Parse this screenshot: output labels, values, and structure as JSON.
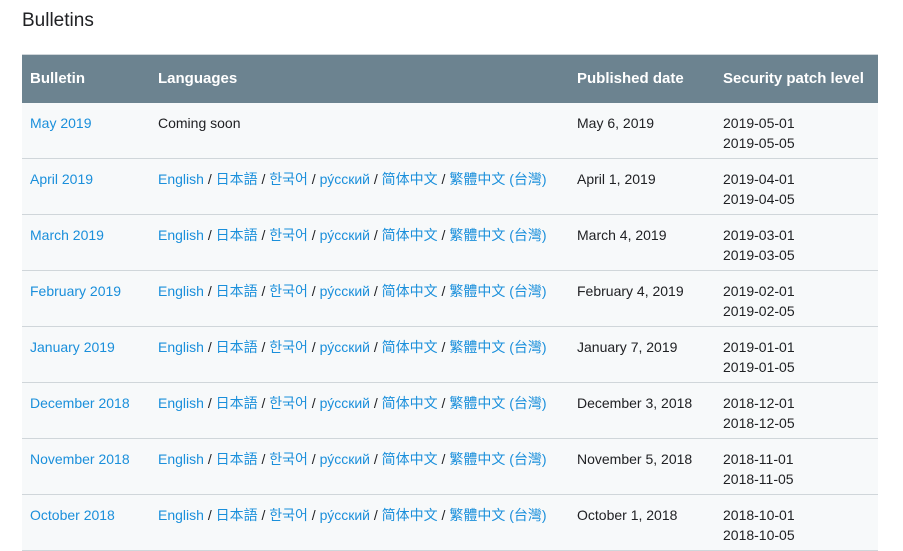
{
  "title": "Bulletins",
  "headers": {
    "bulletin": "Bulletin",
    "languages": "Languages",
    "published": "Published date",
    "patch": "Security patch level"
  },
  "language_links": [
    "English",
    "日本語",
    "한국어",
    "ру́сский",
    "简体中文",
    "繁體中文 (台灣)"
  ],
  "separator": "/",
  "rows": [
    {
      "bulletin": "May 2019",
      "languages_text": "Coming soon",
      "published": "May 6, 2019",
      "patch1": "2019-05-01",
      "patch2": "2019-05-05"
    },
    {
      "bulletin": "April 2019",
      "published": "April 1, 2019",
      "patch1": "2019-04-01",
      "patch2": "2019-04-05"
    },
    {
      "bulletin": "March 2019",
      "published": "March 4, 2019",
      "patch1": "2019-03-01",
      "patch2": "2019-03-05"
    },
    {
      "bulletin": "February 2019",
      "published": "February 4, 2019",
      "patch1": "2019-02-01",
      "patch2": "2019-02-05"
    },
    {
      "bulletin": "January 2019",
      "published": "January 7, 2019",
      "patch1": "2019-01-01",
      "patch2": "2019-01-05"
    },
    {
      "bulletin": "December 2018",
      "published": "December 3, 2018",
      "patch1": "2018-12-01",
      "patch2": "2018-12-05"
    },
    {
      "bulletin": "November 2018",
      "published": "November 5, 2018",
      "patch1": "2018-11-01",
      "patch2": "2018-11-05"
    },
    {
      "bulletin": "October 2018",
      "published": "October 1, 2018",
      "patch1": "2018-10-01",
      "patch2": "2018-10-05"
    }
  ]
}
